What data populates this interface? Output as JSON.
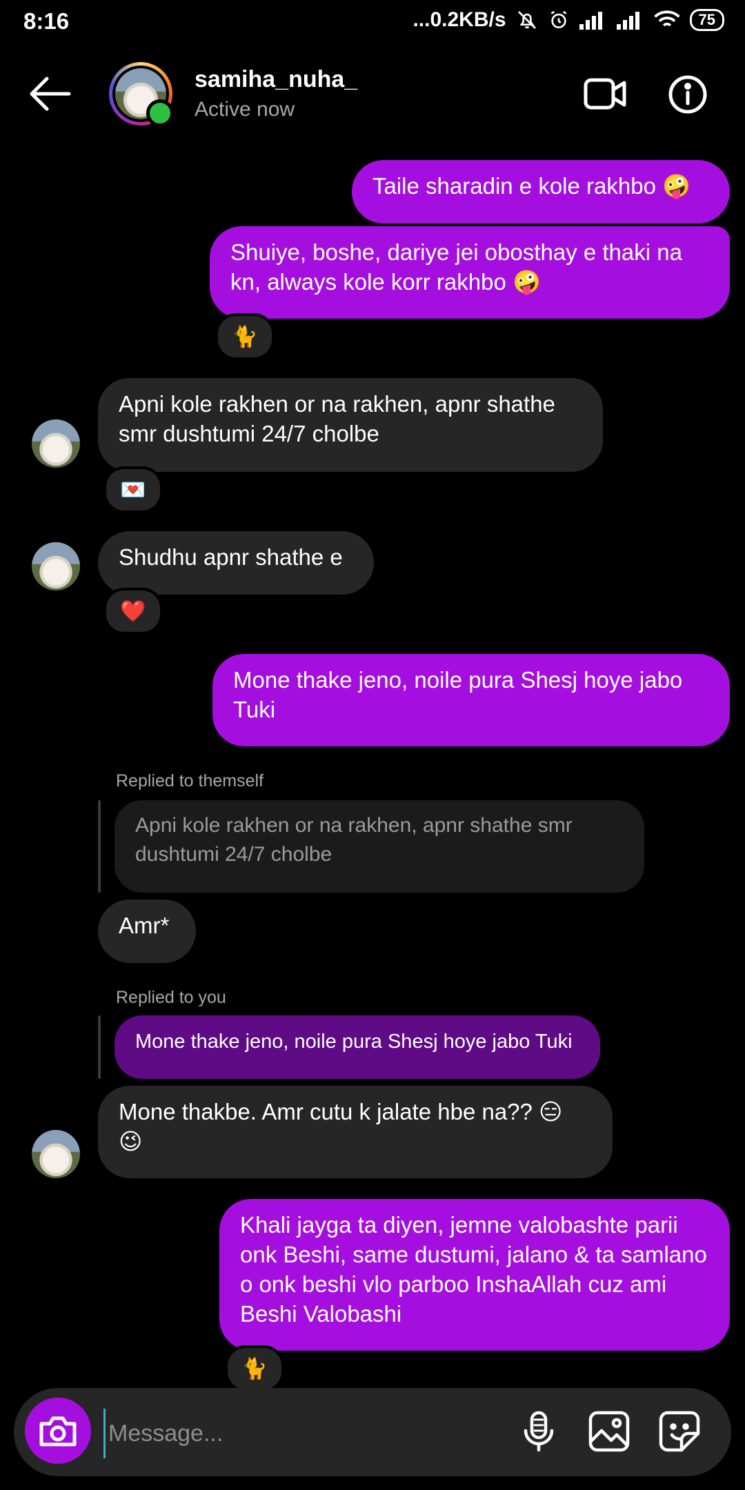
{
  "status_bar": {
    "time": "8:16",
    "speed": "...0.2KB/s",
    "battery": "75"
  },
  "header": {
    "username": "samiha_nuha_",
    "status": "Active now",
    "back_icon": "arrow-left-icon",
    "video_icon": "video-camera-icon",
    "info_icon": "info-icon"
  },
  "messages": [
    {
      "from": "me",
      "text": "Taile sharadin e kole rakhbo 🤪"
    },
    {
      "from": "me",
      "text": "Shuiye, boshe, dariye jei obosthay e thaki na kn, always kole korr rakhbo 🤪",
      "reaction": "🐈"
    },
    {
      "from": "them",
      "text": "Apni kole rakhen or na rakhen, apnr shathe smr dushtumi 24/7 cholbe",
      "reaction": "💌"
    },
    {
      "from": "them",
      "text": "Shudhu apnr shathe e",
      "reaction": "❤️"
    },
    {
      "from": "me",
      "text": "Mone thake jeno, noile pura Shesj hoye jabo Tuki"
    },
    {
      "from": "them",
      "replied_label": "Replied to themself",
      "quote": "Apni kole rakhen or na rakhen, apnr shathe smr dushtumi 24/7 cholbe",
      "text": "Amr*"
    },
    {
      "from": "them",
      "replied_label": "Replied to you",
      "quote": "Mone thake jeno, noile pura Shesj hoye jabo Tuki",
      "text": "Mone thakbe. Amr cutu k jalate hbe na?? 😑 😉"
    },
    {
      "from": "me",
      "text": "Khali jayga ta diyen, jemne valobashte parii onk Beshi, same dustumi, jalano & ta samlano o onk beshi vlo parboo InshaAllah cuz ami Beshi Valobashi",
      "reaction": "🐈"
    }
  ],
  "composer": {
    "placeholder": "Message...",
    "camera_icon": "camera-icon",
    "mic_icon": "microphone-icon",
    "gallery_icon": "gallery-icon",
    "sticker_icon": "sticker-icon"
  },
  "colors": {
    "outgoing_bubble": "#a40fe0",
    "incoming_bubble": "#262626",
    "background": "#000000",
    "online_dot": "#2fc043"
  }
}
